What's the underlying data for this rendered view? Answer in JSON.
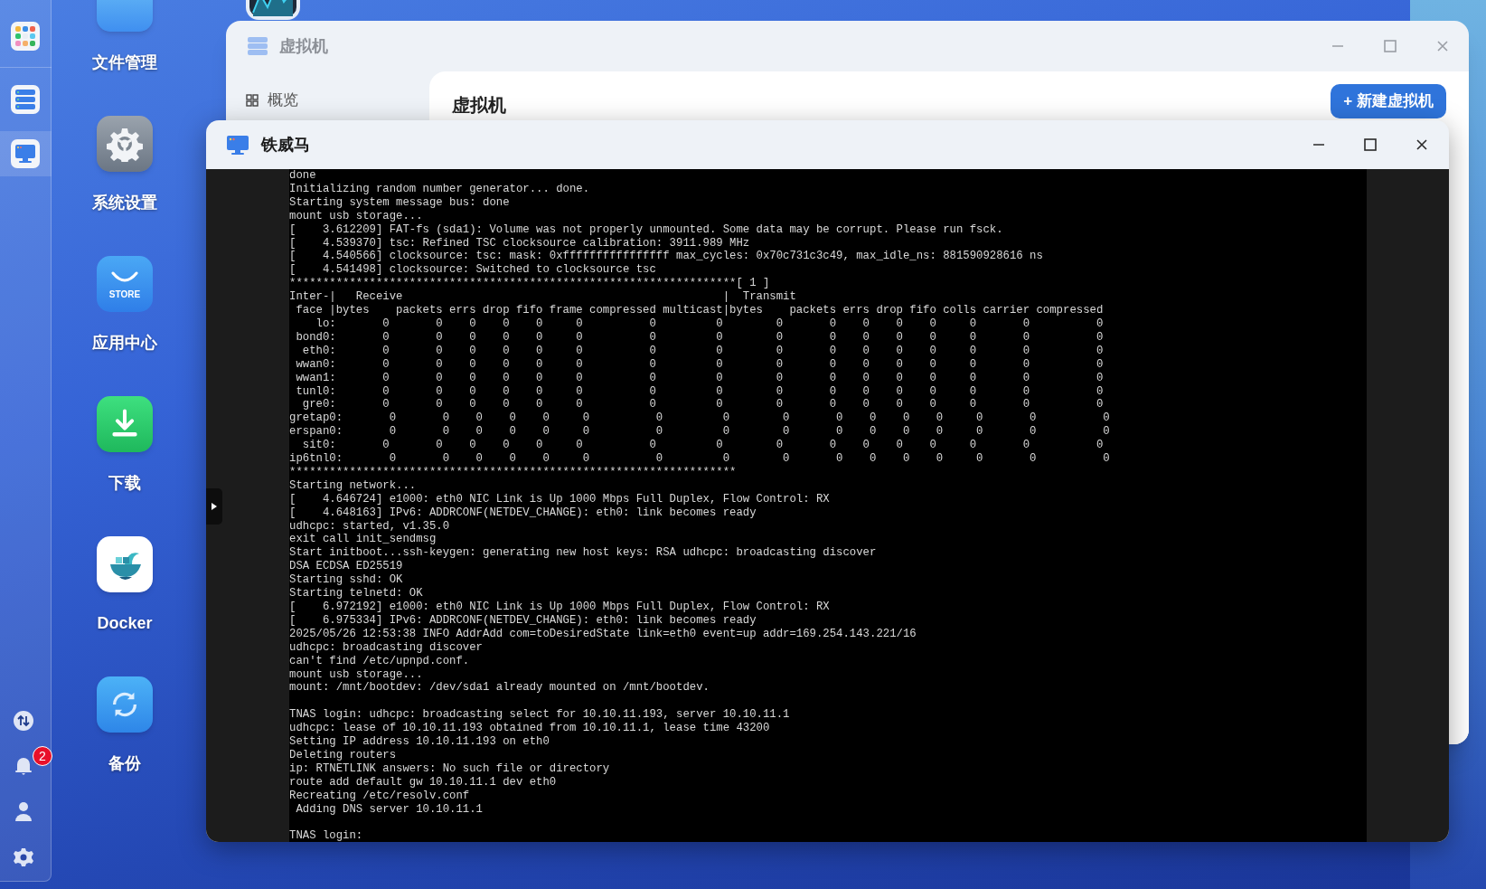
{
  "desktop_icons": [
    {
      "kind": "files",
      "label": "文件管理"
    },
    {
      "kind": "settings",
      "label": "系统设置"
    },
    {
      "kind": "store",
      "label": "应用中心",
      "icon_text": "STORE"
    },
    {
      "kind": "download",
      "label": "下载"
    },
    {
      "kind": "docker",
      "label": "Docker"
    },
    {
      "kind": "backup",
      "label": "备份"
    }
  ],
  "dock": {
    "apps": [
      {
        "kind": "apps",
        "selected": false
      },
      {
        "kind": "vm",
        "selected": false
      },
      {
        "kind": "terminal",
        "selected": true
      }
    ],
    "tools": [
      {
        "kind": "transfer"
      },
      {
        "kind": "notifications",
        "badge": "2"
      },
      {
        "kind": "user"
      },
      {
        "kind": "settings"
      }
    ]
  },
  "vm_window": {
    "title": "虚拟机",
    "sidebar": {
      "items": [
        {
          "label": "概览"
        }
      ]
    },
    "heading": "虚拟机",
    "new_button": "+ 新建虚拟机"
  },
  "console_window": {
    "title": "铁威马",
    "terminal": {
      "blocks": [
        [
          "done",
          "Initializing random number generator... done.",
          "Starting system message bus: done",
          "mount usb storage...",
          "[    3.612209] FAT-fs (sda1): Volume was not properly unmounted. Some data may be corrupt. Please run fsck.",
          "[    4.539370] tsc: Refined TSC clocksource calibration: 3911.989 MHz",
          "[    4.540566] clocksource: tsc: mask: 0xffffffffffffffff max_cycles: 0x70c731c3c49, max_idle_ns: 881590928616 ns",
          "[    4.541498] clocksource: Switched to clocksource tsc",
          "*******************************************************************[ 1 ]",
          "Inter-|   Receive                                                |  Transmit",
          " face |bytes    packets errs drop fifo frame compressed multicast|bytes    packets errs drop fifo colls carrier compressed",
          "    lo:       0       0    0    0    0     0          0         0        0       0    0    0    0     0       0          0",
          " bond0:       0       0    0    0    0     0          0         0        0       0    0    0    0     0       0          0",
          "  eth0:       0       0    0    0    0     0          0         0        0       0    0    0    0     0       0          0",
          " wwan0:       0       0    0    0    0     0          0         0        0       0    0    0    0     0       0          0",
          " wwan1:       0       0    0    0    0     0          0         0        0       0    0    0    0     0       0          0",
          " tunl0:       0       0    0    0    0     0          0         0        0       0    0    0    0     0       0          0",
          "  gre0:       0       0    0    0    0     0          0         0        0       0    0    0    0     0       0          0",
          "gretap0:       0       0    0    0    0     0          0         0        0       0    0    0    0     0       0          0",
          "erspan0:       0       0    0    0    0     0          0         0        0       0    0    0    0     0       0          0",
          "  sit0:       0       0    0    0    0     0          0         0        0       0    0    0    0     0       0          0",
          "ip6tnl0:       0       0    0    0    0     0          0         0        0       0    0    0    0     0       0          0",
          "*******************************************************************",
          "Starting network...",
          "[    4.646724] e1000: eth0 NIC Link is Up 1000 Mbps Full Duplex, Flow Control: RX",
          "[    4.648163] IPv6: ADDRCONF(NETDEV_CHANGE): eth0: link becomes ready",
          "udhcpc: started, v1.35.0",
          "exit call init_sendmsg",
          "Start initboot...ssh-keygen: generating new host keys: RSA udhcpc: broadcasting discover",
          "DSA ECDSA ED25519",
          "Starting sshd: OK",
          "Starting telnetd: OK",
          "[    6.972192] e1000: eth0 NIC Link is Up 1000 Mbps Full Duplex, Flow Control: RX",
          "[    6.975334] IPv6: ADDRCONF(NETDEV_CHANGE): eth0: link becomes ready",
          "2025/05/26 12:53:38 INFO AddrAdd com=toDesiredState link=eth0 event=up addr=169.254.143.221/16",
          "udhcpc: broadcasting discover",
          "can't find /etc/upnpd.conf.",
          "mount usb storage...",
          "mount: /mnt/bootdev: /dev/sda1 already mounted on /mnt/bootdev."
        ],
        [
          "TNAS login: udhcpc: broadcasting select for 10.10.11.193, server 10.10.11.1",
          "udhcpc: lease of 10.10.11.193 obtained from 10.10.11.1, lease time 43200",
          "Setting IP address 10.10.11.193 on eth0",
          "Deleting routers",
          "ip: RTNETLINK answers: No such file or directory",
          "route add default gw 10.10.11.1 dev eth0",
          "Recreating /etc/resolv.conf",
          " Adding DNS server 10.10.11.1"
        ],
        [
          "TNAS login:"
        ]
      ]
    }
  }
}
